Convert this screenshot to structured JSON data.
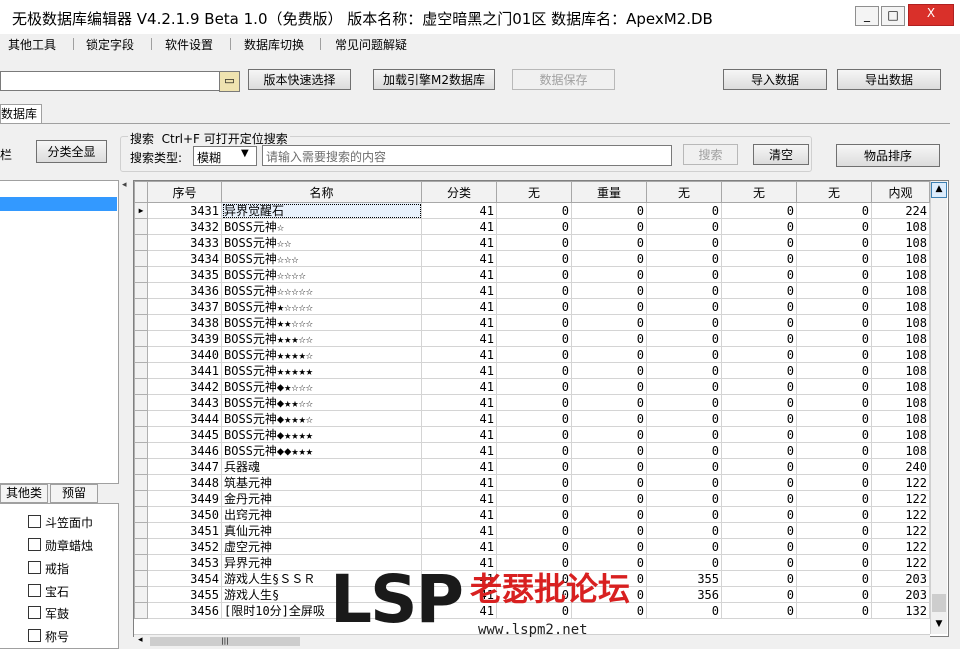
{
  "window": {
    "title": "无极数据库编辑器 V4.2.1.9   Beta 1.0（免费版）   版本名称：虚空暗黑之门01区   数据库名：ApexM2.DB",
    "minimize": "_",
    "maximize": "□",
    "close": "X"
  },
  "menu": [
    "其他工具",
    "锁定字段",
    "软件设置",
    "数据库切换",
    "常见问题解疑"
  ],
  "toolbar": {
    "path_value": "",
    "folder_icon": "folder-icon",
    "version_quick_select": "版本快速选择",
    "load_engine_db": "加载引擎M2数据库",
    "save_data": "数据保存",
    "import_data": "导入数据",
    "export_data": "导出数据"
  },
  "tabs": {
    "active": "数据库"
  },
  "left": {
    "label": "栏",
    "show_all_button": "分类全显",
    "bottom_tabs": [
      "其他类",
      "预留"
    ],
    "categories": [
      "斗笠面巾",
      "勋章蜡烛",
      "戒指",
      "宝石",
      "军鼓",
      "称号"
    ]
  },
  "search": {
    "hint": "搜索  Ctrl+F 可打开定位搜索",
    "type_label": "搜索类型:",
    "type_value": "模糊",
    "input_value": "",
    "placeholder": "请输入需要搜索的内容",
    "search_button": "搜索",
    "clear_button": "清空",
    "sort_button": "物品排序"
  },
  "grid": {
    "columns": [
      "序号",
      "名称",
      "分类",
      "无",
      "重量",
      "无",
      "无",
      "无",
      "内观"
    ],
    "rows": [
      [
        "3431",
        "异界觉醒石",
        "41",
        "0",
        "0",
        "0",
        "0",
        "0",
        "224"
      ],
      [
        "3432",
        "BOSS元神☆",
        "41",
        "0",
        "0",
        "0",
        "0",
        "0",
        "108"
      ],
      [
        "3433",
        "BOSS元神☆☆",
        "41",
        "0",
        "0",
        "0",
        "0",
        "0",
        "108"
      ],
      [
        "3434",
        "BOSS元神☆☆☆",
        "41",
        "0",
        "0",
        "0",
        "0",
        "0",
        "108"
      ],
      [
        "3435",
        "BOSS元神☆☆☆☆",
        "41",
        "0",
        "0",
        "0",
        "0",
        "0",
        "108"
      ],
      [
        "3436",
        "BOSS元神☆☆☆☆☆",
        "41",
        "0",
        "0",
        "0",
        "0",
        "0",
        "108"
      ],
      [
        "3437",
        "BOSS元神★☆☆☆☆",
        "41",
        "0",
        "0",
        "0",
        "0",
        "0",
        "108"
      ],
      [
        "3438",
        "BOSS元神★★☆☆☆",
        "41",
        "0",
        "0",
        "0",
        "0",
        "0",
        "108"
      ],
      [
        "3439",
        "BOSS元神★★★☆☆",
        "41",
        "0",
        "0",
        "0",
        "0",
        "0",
        "108"
      ],
      [
        "3440",
        "BOSS元神★★★★☆",
        "41",
        "0",
        "0",
        "0",
        "0",
        "0",
        "108"
      ],
      [
        "3441",
        "BOSS元神★★★★★",
        "41",
        "0",
        "0",
        "0",
        "0",
        "0",
        "108"
      ],
      [
        "3442",
        "BOSS元神◆★☆☆☆",
        "41",
        "0",
        "0",
        "0",
        "0",
        "0",
        "108"
      ],
      [
        "3443",
        "BOSS元神◆★★☆☆",
        "41",
        "0",
        "0",
        "0",
        "0",
        "0",
        "108"
      ],
      [
        "3444",
        "BOSS元神◆★★★☆",
        "41",
        "0",
        "0",
        "0",
        "0",
        "0",
        "108"
      ],
      [
        "3445",
        "BOSS元神◆★★★★",
        "41",
        "0",
        "0",
        "0",
        "0",
        "0",
        "108"
      ],
      [
        "3446",
        "BOSS元神◆◆★★★",
        "41",
        "0",
        "0",
        "0",
        "0",
        "0",
        "108"
      ],
      [
        "3447",
        "兵器魂",
        "41",
        "0",
        "0",
        "0",
        "0",
        "0",
        "240"
      ],
      [
        "3448",
        "筑基元神",
        "41",
        "0",
        "0",
        "0",
        "0",
        "0",
        "122"
      ],
      [
        "3449",
        "金丹元神",
        "41",
        "0",
        "0",
        "0",
        "0",
        "0",
        "122"
      ],
      [
        "3450",
        "出窍元神",
        "41",
        "0",
        "0",
        "0",
        "0",
        "0",
        "122"
      ],
      [
        "3451",
        "真仙元神",
        "41",
        "0",
        "0",
        "0",
        "0",
        "0",
        "122"
      ],
      [
        "3452",
        "虚空元神",
        "41",
        "0",
        "0",
        "0",
        "0",
        "0",
        "122"
      ],
      [
        "3453",
        "异界元神",
        "41",
        "0",
        "0",
        "0",
        "0",
        "0",
        "122"
      ],
      [
        "3454",
        "游戏人生§ＳＳＲ",
        "41",
        "0",
        "0",
        "355",
        "0",
        "0",
        "203"
      ],
      [
        "3455",
        "游戏人生§",
        "41",
        "0",
        "0",
        "356",
        "0",
        "0",
        "203"
      ],
      [
        "3456",
        "[限时10分]全屏吸",
        "41",
        "0",
        "0",
        "0",
        "0",
        "0",
        "132"
      ]
    ]
  },
  "watermark": {
    "logo": "LSP",
    "name": "老瑟批论坛",
    "url": "www.lspm2.net"
  },
  "colors": {
    "selection": "#3399ff",
    "close_button": "#d9302a",
    "watermark_red": "#d82020"
  }
}
